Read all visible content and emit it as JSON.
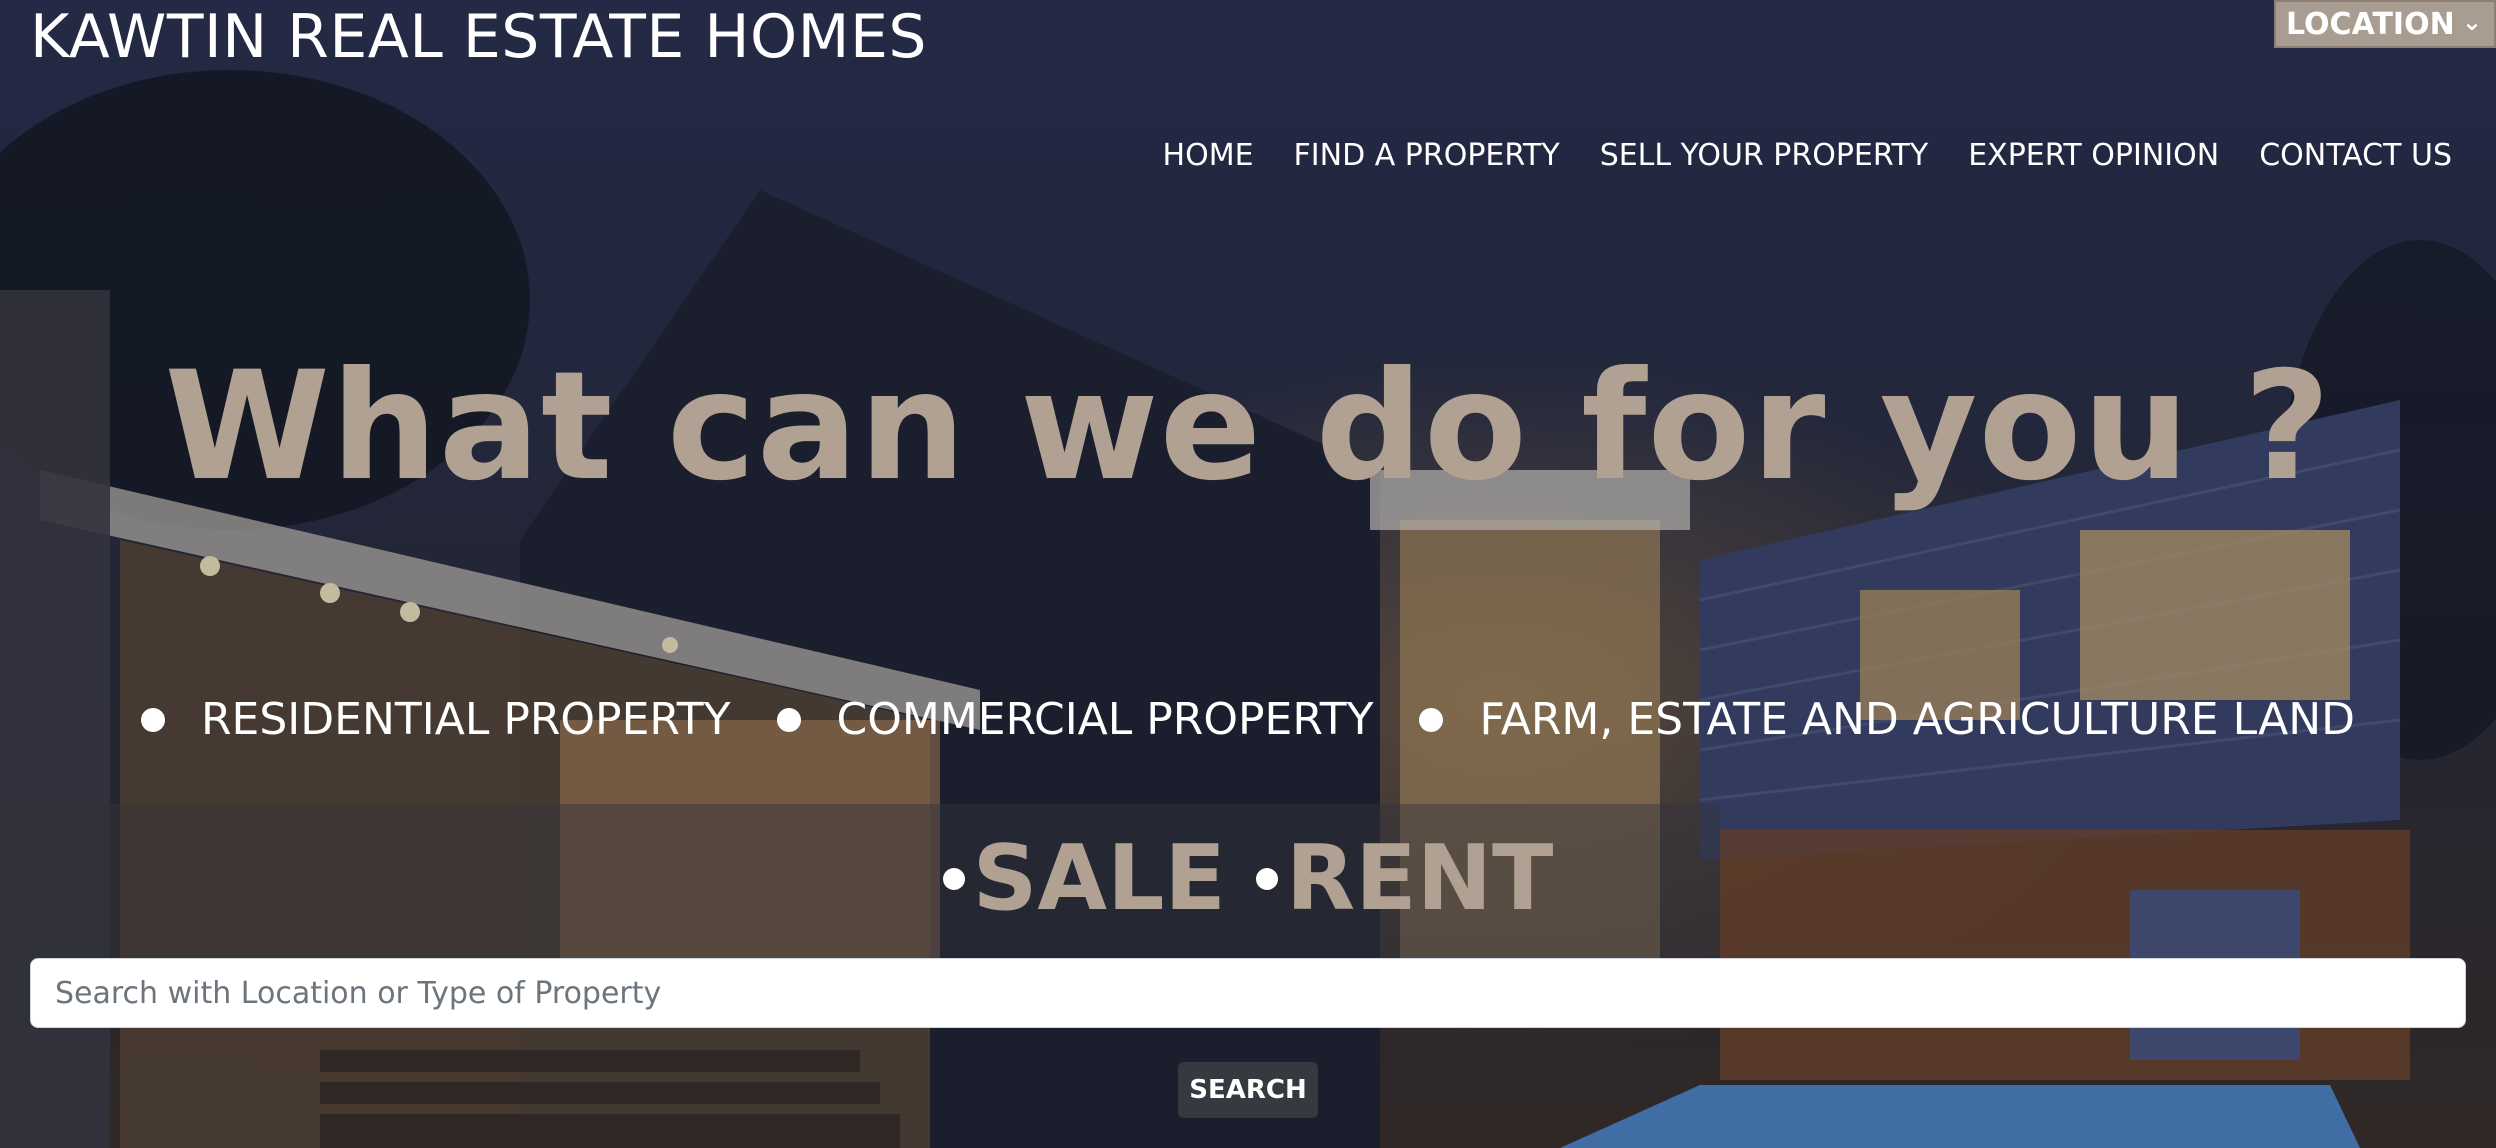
{
  "header": {
    "brand": "KAWTIN REAL ESTATE HOMES",
    "location_select": {
      "selected": "LOCATION",
      "icon": "chevron-down-icon"
    }
  },
  "nav": {
    "items": [
      {
        "label": "HOME"
      },
      {
        "label": "FIND A PROPERTY"
      },
      {
        "label": "SELL YOUR PROPERTY"
      },
      {
        "label": "EXPERT OPINION"
      },
      {
        "label": "CONTACT US"
      }
    ]
  },
  "hero": {
    "headline": "What can we do for you ?",
    "categories": [
      {
        "label": "RESIDENTIAL PROPERTY"
      },
      {
        "label": "COMMERCIAL PROPERTY"
      },
      {
        "label": "FARM, ESTATE AND AGRICULTURE LAND"
      }
    ],
    "modes": [
      {
        "label": "SALE"
      },
      {
        "label": "RENT"
      }
    ]
  },
  "search": {
    "placeholder": "Search with Location or Type of Property",
    "value": "",
    "button_label": "SEARCH"
  },
  "colors": {
    "headline": "#b0a193",
    "location_bg": "#a99c90",
    "button_bg": "#343a40"
  }
}
